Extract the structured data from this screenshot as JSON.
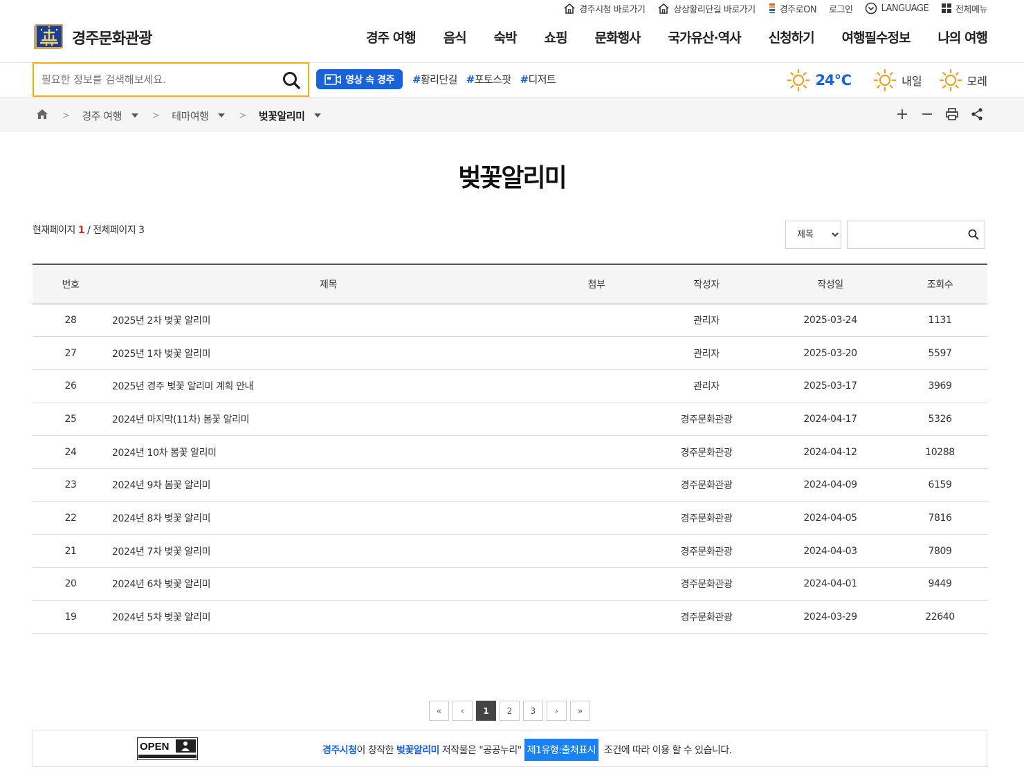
{
  "utility": {
    "links": [
      {
        "label": "경주시청 바로가기",
        "icon": "home-icon"
      },
      {
        "label": "상상황리단길 바로가기",
        "icon": "home-icon"
      },
      {
        "label": "경주로ON",
        "icon": "app-icon"
      },
      {
        "label": "로그인",
        "icon": ""
      },
      {
        "label": "LANGUAGE",
        "icon": "chevron-circle-icon"
      },
      {
        "label": "전체메뉴",
        "icon": "grid-icon"
      }
    ]
  },
  "header": {
    "logo_text": "경주문화관광",
    "nav": [
      "경주 여행",
      "음식",
      "숙박",
      "쇼핑",
      "문화행사",
      "국가유산·역사",
      "신청하기",
      "여행필수정보",
      "나의 여행"
    ]
  },
  "search": {
    "placeholder": "필요한 정보를 검색해보세요.",
    "video_button": "영상 속 경주",
    "tags": [
      "황리단길",
      "포토스팟",
      "디저트"
    ]
  },
  "weather": {
    "today_temp": "24℃",
    "tomorrow_label": "내일",
    "after_label": "모레",
    "icon_color": "#f0a020"
  },
  "breadcrumb": {
    "items": [
      "경주 여행",
      "테마여행",
      "벚꽃알리미"
    ]
  },
  "page": {
    "title": "벚꽃알리미",
    "current_label": "현재페이지",
    "current_page": "1",
    "total_label": "/ 전체페이지",
    "total_pages": "3"
  },
  "board_search": {
    "select_value": "제목",
    "keyword_value": ""
  },
  "table": {
    "headers": [
      "번호",
      "제목",
      "첨부",
      "작성자",
      "작성일",
      "조회수"
    ],
    "rows": [
      {
        "no": "28",
        "title": "2025년 2차 벚꽃 알리미",
        "attach": "",
        "author": "관리자",
        "date": "2025-03-24",
        "views": "1131"
      },
      {
        "no": "27",
        "title": "2025년 1차 벚꽃 알리미",
        "attach": "",
        "author": "관리자",
        "date": "2025-03-20",
        "views": "5597"
      },
      {
        "no": "26",
        "title": "2025년 경주 벚꽃 알리미 계획 안내",
        "attach": "",
        "author": "관리자",
        "date": "2025-03-17",
        "views": "3969"
      },
      {
        "no": "25",
        "title": "2024년 마지막(11차) 봄꽃 알리미",
        "attach": "",
        "author": "경주문화관광",
        "date": "2024-04-17",
        "views": "5326"
      },
      {
        "no": "24",
        "title": "2024년 10차 봄꽃 알리미",
        "attach": "",
        "author": "경주문화관광",
        "date": "2024-04-12",
        "views": "10288"
      },
      {
        "no": "23",
        "title": "2024년 9차 봄꽃 알리미",
        "attach": "",
        "author": "경주문화관광",
        "date": "2024-04-09",
        "views": "6159"
      },
      {
        "no": "22",
        "title": "2024년 8차 벚꽃 알리미",
        "attach": "",
        "author": "경주문화관광",
        "date": "2024-04-05",
        "views": "7816"
      },
      {
        "no": "21",
        "title": "2024년 7차 벚꽃 알리미",
        "attach": "",
        "author": "경주문화관광",
        "date": "2024-04-03",
        "views": "7809"
      },
      {
        "no": "20",
        "title": "2024년 6차 벚꽃 알리미",
        "attach": "",
        "author": "경주문화관광",
        "date": "2024-04-01",
        "views": "9449"
      },
      {
        "no": "19",
        "title": "2024년 5차 벚꽃 알리미",
        "attach": "",
        "author": "경주문화관광",
        "date": "2024-03-29",
        "views": "22640"
      }
    ]
  },
  "paging": {
    "first": "«",
    "prev": "‹",
    "pages": [
      "1",
      "2",
      "3"
    ],
    "current": "1",
    "next": "›",
    "last": "»"
  },
  "license": {
    "logo_text": "OPEN",
    "org": "경주시청",
    "t1": "이 창작한 ",
    "work": "벚꽃알리미",
    "t2": " 저작물은 \"공공누리\"",
    "type": "제1유형:출처표시",
    "t3": " 조건에 따라 이용 할 수 있습니다."
  },
  "colors": {
    "accent": "#1a62d9",
    "search_border": "#f0b400",
    "current_page": "#d52b1e"
  }
}
